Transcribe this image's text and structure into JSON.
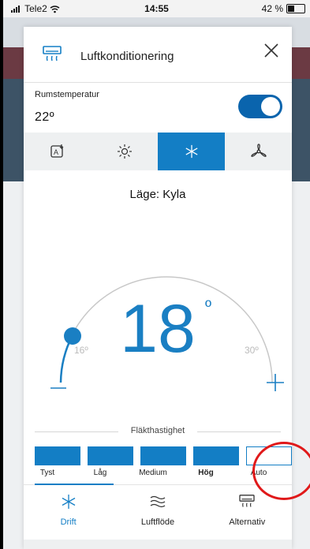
{
  "status_bar": {
    "carrier": "Tele2",
    "time": "14:55",
    "battery": "42 %",
    "battery_level": 0.42
  },
  "header": {
    "title": "Luftkonditionering",
    "icon": "air-conditioner-icon"
  },
  "room": {
    "label": "Rumstemperatur",
    "value": "22º",
    "toggle_on": true
  },
  "modes": [
    {
      "name": "auto-mode",
      "icon": "auto-icon",
      "active": false
    },
    {
      "name": "heat-mode",
      "icon": "sun-icon",
      "active": false
    },
    {
      "name": "cool-mode",
      "icon": "snowflake-icon",
      "active": true
    },
    {
      "name": "fan-mode",
      "icon": "fan-icon",
      "active": false
    }
  ],
  "mode_text": "Läge: Kyla",
  "setpoint": {
    "value": "18",
    "unit": "º",
    "min": "16º",
    "max": "30º"
  },
  "fan": {
    "title": "Fläkthastighet",
    "levels": [
      "Tyst",
      "Låg",
      "Medium",
      "Hög",
      "Auto"
    ],
    "selected": "Hög"
  },
  "tabs": [
    {
      "label": "Drift",
      "icon": "snowflake-icon",
      "active": true
    },
    {
      "label": "Luftflöde",
      "icon": "airflow-icon",
      "active": false
    },
    {
      "label": "Alternativ",
      "icon": "air-conditioner-icon",
      "active": false
    }
  ],
  "colors": {
    "accent": "#137ec5",
    "toggle": "#0a64ad",
    "highlight": "#e0191a"
  }
}
